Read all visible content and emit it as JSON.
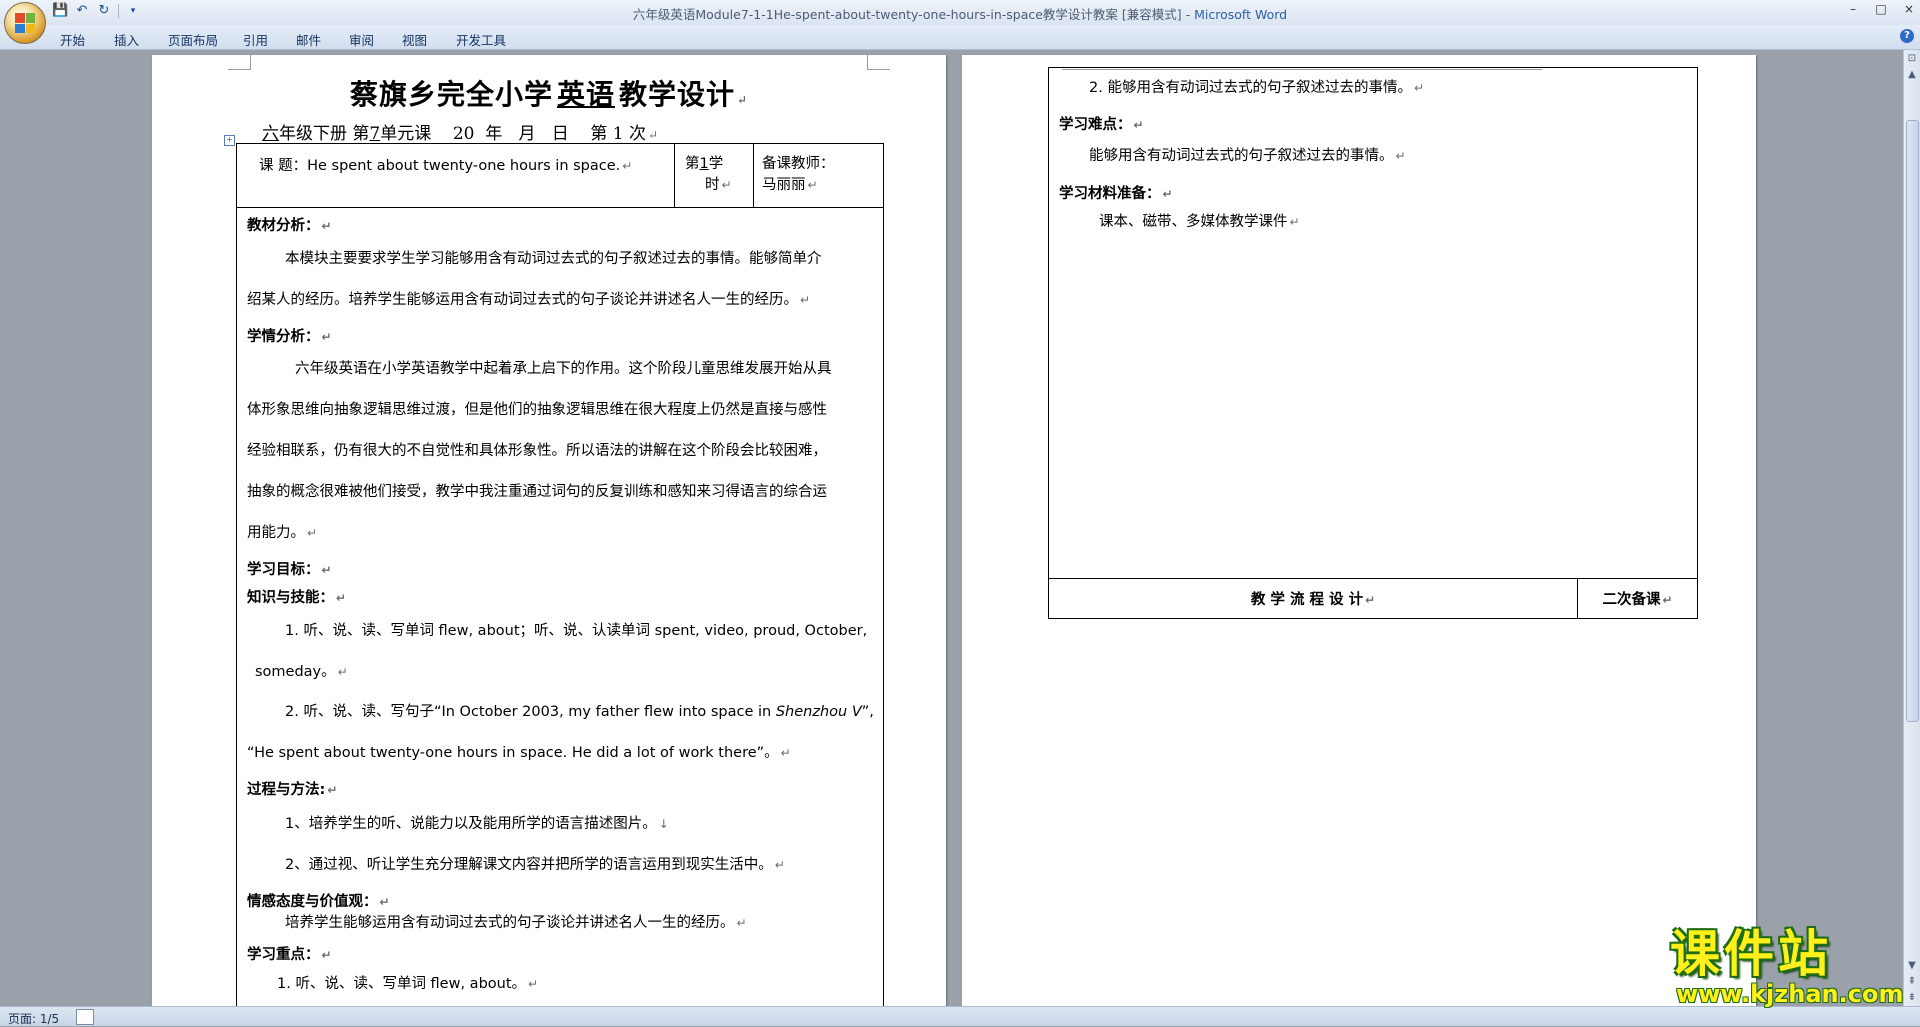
{
  "window": {
    "doc_name": "六年级英语Module7-1-1He-spent-about-twenty-one-hours-in-space教学设计教案 [兼容模式]",
    "separator": " - ",
    "app_name": "Microsoft Word",
    "controls": [
      "–",
      "□",
      "×"
    ]
  },
  "ribbon": {
    "tabs": [
      "开始",
      "插入",
      "页面布局",
      "引用",
      "邮件",
      "审阅",
      "视图",
      "开发工具"
    ]
  },
  "quick_access": [
    "save-icon",
    "undo-icon",
    "redo-icon",
    "customize-icon"
  ],
  "left_page": {
    "title_prefix": "蔡旗乡完全小学",
    "title_subject": "英语",
    "title_suffix": "教学设计",
    "sub_grade": "六",
    "sub_grade_text": "年级下册 第",
    "sub_unit": "7",
    "sub_rest": "单元课    20  年   月   日    第 1 次",
    "topic_label": "课    题：",
    "topic_value": "He spent about twenty-one hours in space.",
    "lesson_prefix": "第",
    "lesson_num": "1",
    "lesson_suffix_a": "学",
    "lesson_suffix_b": "时",
    "teacher_label": "备课教师：",
    "teacher_name": "马丽丽",
    "h_material": "教材分析：",
    "material_l1": "本模块主要要求学生学习能够用含有动词过去式的句子叙述过去的事情。能够简单介",
    "material_l2": "绍某人的经历。培养学生能够运用含有动词过去式的句子谈论并讲述名人一生的经历。",
    "h_student": "学情分析：",
    "student_l1": "六年级英语在小学英语教学中起着承上启下的作用。这个阶段儿童思维发展开始从具",
    "student_l2": "体形象思维向抽象逻辑思维过渡，但是他们的抽象逻辑思维在很大程度上仍然是直接与感性",
    "student_l3": "经验相联系，仍有很大的不自觉性和具体形象性。所以语法的讲解在这个阶段会比较困难，",
    "student_l4": "抽象的概念很难被他们接受，教学中我注重通过词句的反复训练和感知来习得语言的综合运",
    "student_l5": "用能力。",
    "h_goal": "学习目标：",
    "h_knowledge": "知识与技能：",
    "k1_l1": "1. 听、说、读、写单词 flew, about；听、说、认读单词 spent, video, proud, October,",
    "k1_l2": "someday。",
    "k2_l1a": "2. 听、说、读、写句子“In October 2003, my father flew into space in ",
    "k2_l1b": "Shenzhou V",
    "k2_l1c": "”,",
    "k2_l2": "“He spent about twenty-one hours in space. He did a lot of work there”。",
    "h_process": "过程与方法:",
    "p1": "1、培养学生的听、说能力以及能用所学的语言描述图片。",
    "p2": "2、通过视、听让学生充分理解课文内容并把所学的语言运用到现实生活中。",
    "h_emotion": "情感态度与价值观：",
    "emotion": "培养学生能够运用含有动词过去式的句子谈论并讲述名人一生的经历。",
    "h_key": "学习重点：",
    "key1": "1. 听、说、读、写单词 flew, about。"
  },
  "right_page": {
    "point2": "2. 能够用含有动词过去式的句子叙述过去的事情。",
    "h_difficulty": "学习难点：",
    "difficulty": "能够用含有动词过去式的句子叙述过去的事情。",
    "h_materials": "学习材料准备：",
    "materials": "课本、磁带、多媒体教学课件",
    "flow_label": "教  学  流  程  设  计",
    "second_prep": "二次备课"
  },
  "status": {
    "page_info": "页面: 1/5"
  },
  "watermark": {
    "brand": "课件站",
    "url": "www.kjzhan.com"
  }
}
